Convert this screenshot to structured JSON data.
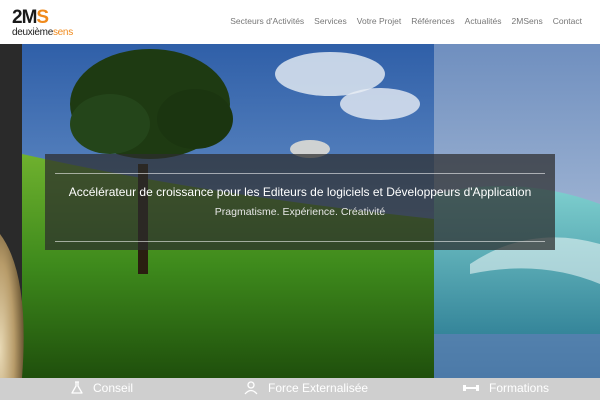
{
  "brand": {
    "logo_top_a": "2M",
    "logo_top_b": "S",
    "logo_bottom_a": "deuxième",
    "logo_bottom_b": "sens",
    "accent_color": "#f08a1c"
  },
  "nav": {
    "items": [
      {
        "label": "Secteurs d'Activités"
      },
      {
        "label": "Services"
      },
      {
        "label": "Votre Projet"
      },
      {
        "label": "Références"
      },
      {
        "label": "Actualités"
      },
      {
        "label": "2MSens"
      },
      {
        "label": "Contact"
      }
    ]
  },
  "hero": {
    "headline": "Accélérateur de croissance pour les Editeurs de logiciels et Développeurs d'Application",
    "tagline": "Pragmatisme. Expérience. Créativité"
  },
  "services": {
    "items": [
      {
        "label": "Conseil",
        "icon": "flask-icon"
      },
      {
        "label": "Force Externalisée",
        "icon": "users-icon"
      },
      {
        "label": "Formations",
        "icon": "dumbbell-icon"
      }
    ]
  }
}
